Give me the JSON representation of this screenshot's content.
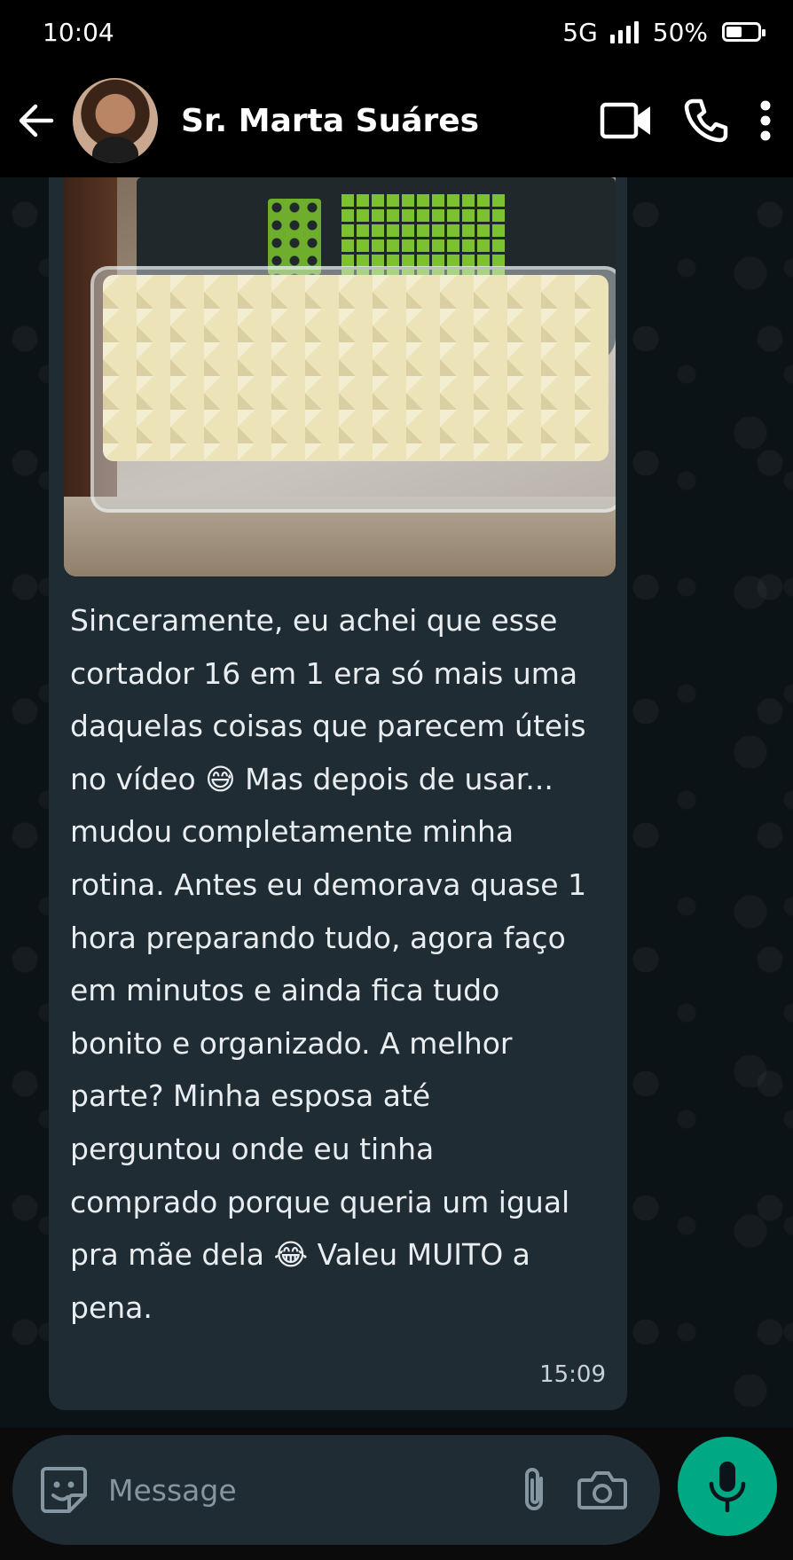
{
  "status_bar": {
    "time": "10:04",
    "network": "5G",
    "battery_percent_text": "50%",
    "battery_level": 0.5
  },
  "header": {
    "contact_name": "Sr. Marta Suáres"
  },
  "message": {
    "text": "Sinceramente, eu achei que esse\ncortador 16 em 1 era só mais uma\ndaquelas coisas que parecem úteis\nno vídeo 😅 Mas depois de usar...\nmudou completamente minha\nrotina. Antes eu demorava quase 1\nhora preparando tudo, agora faço\nem minutos e ainda fica tudo\nbonito e organizado. A melhor\nparte? Minha esposa até\nperguntou onde eu tinha\ncomprado porque queria um igual\npra mãe dela 😂 Valeu MUITO a\npena.",
    "time": "15:09"
  },
  "composer": {
    "placeholder": "Message"
  },
  "colors": {
    "accent": "#00a884",
    "bubble": "#1f2c33",
    "chat_bg": "#0c1317"
  },
  "icons": [
    "back-arrow-icon",
    "video-call-icon",
    "phone-icon",
    "more-vert-icon",
    "sticker-icon",
    "attach-icon",
    "camera-icon",
    "mic-icon"
  ]
}
